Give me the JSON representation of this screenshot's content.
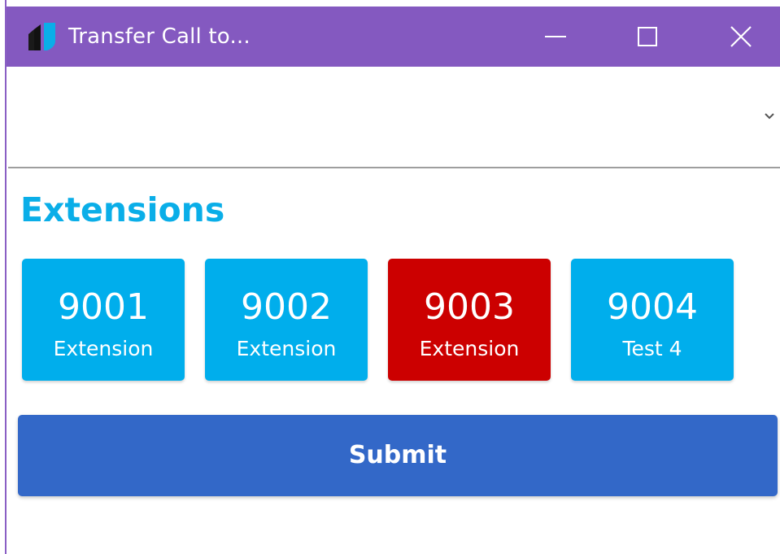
{
  "window": {
    "title": "Transfer Call to...",
    "accent_color": "#8459c0"
  },
  "controls": {
    "minimize_icon": "minimize-icon",
    "maximize_icon": "maximize-icon",
    "close_icon": "close-icon"
  },
  "combo": {
    "value": "",
    "icon": "chevron-down-icon"
  },
  "extensions": {
    "title": "Extensions",
    "title_color": "#0aaee8",
    "items": [
      {
        "number": "9001",
        "label": "Extension",
        "color": "#00aeec"
      },
      {
        "number": "9002",
        "label": "Extension",
        "color": "#00aeec"
      },
      {
        "number": "9003",
        "label": "Extension",
        "color": "#cc0000"
      },
      {
        "number": "9004",
        "label": "Test 4",
        "color": "#00aeec"
      }
    ]
  },
  "submit": {
    "label": "Submit",
    "color": "#3368c8"
  }
}
